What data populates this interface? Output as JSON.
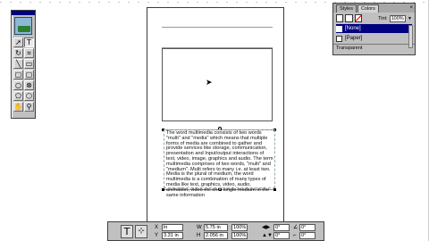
{
  "toolbox": {
    "tools": [
      {
        "name": "pointer-tool-icon",
        "glyph": "➚"
      },
      {
        "name": "text-tool-icon",
        "glyph": "T"
      },
      {
        "name": "rotate-tool-icon",
        "glyph": "↻"
      },
      {
        "name": "crop-tool-icon",
        "glyph": "⌗"
      },
      {
        "name": "line-tool-icon",
        "glyph": "╲"
      },
      {
        "name": "rectangle-tool-icon",
        "glyph": "▭"
      },
      {
        "name": "rectangle-frame-tool-icon",
        "glyph": "▢"
      },
      {
        "name": "rounded-rect-tool-icon",
        "glyph": "▢"
      },
      {
        "name": "ellipse-tool-icon",
        "glyph": "○"
      },
      {
        "name": "ellipse-frame-tool-icon",
        "glyph": "⊗"
      },
      {
        "name": "polygon-tool-icon",
        "glyph": "⬠"
      },
      {
        "name": "polygon-frame-tool-icon",
        "glyph": "⬡"
      },
      {
        "name": "hand-tool-icon",
        "glyph": "✋"
      },
      {
        "name": "zoom-tool-icon",
        "glyph": "⚲"
      }
    ]
  },
  "document": {
    "body_text": "The word multimedia consists of two words \"multi\" and \"media\" which means that multiple forms of media are combined to gather and provide services like storage, communication, presentation and Input/output interactions of text, video, image, graphics and audio. The term multimedia comprises of two words, \"multi\" and \"medium\". Multi refers to many i.e. at least two. Media is the plural of medium, the word multimedia is a combination of many types of media like text, graphics, video, audio, animation, video etc on a single medium in the same information"
  },
  "palette": {
    "tabs": [
      "Styles",
      "Colors"
    ],
    "close_glyph": "×",
    "tint_label": "Tint:",
    "tint_value": "100%",
    "swatches": [
      {
        "label": "[None]",
        "selected": true
      },
      {
        "label": "[Paper]",
        "selected": false
      }
    ],
    "footer": "Transparent"
  },
  "measurements": {
    "x_label": "X",
    "x_value": "ln",
    "y_label": "Y",
    "y_value": "3.31 in",
    "w_label": "W",
    "w_value": "5.75 in",
    "h_label": "H",
    "h_value": "2.056 in",
    "scale_x": "100%",
    "scale_y": "100%",
    "rot_value": "0°",
    "skew_value": "0°",
    "extra_value": "0°"
  },
  "colors": {
    "palette_selection": "#000080"
  }
}
